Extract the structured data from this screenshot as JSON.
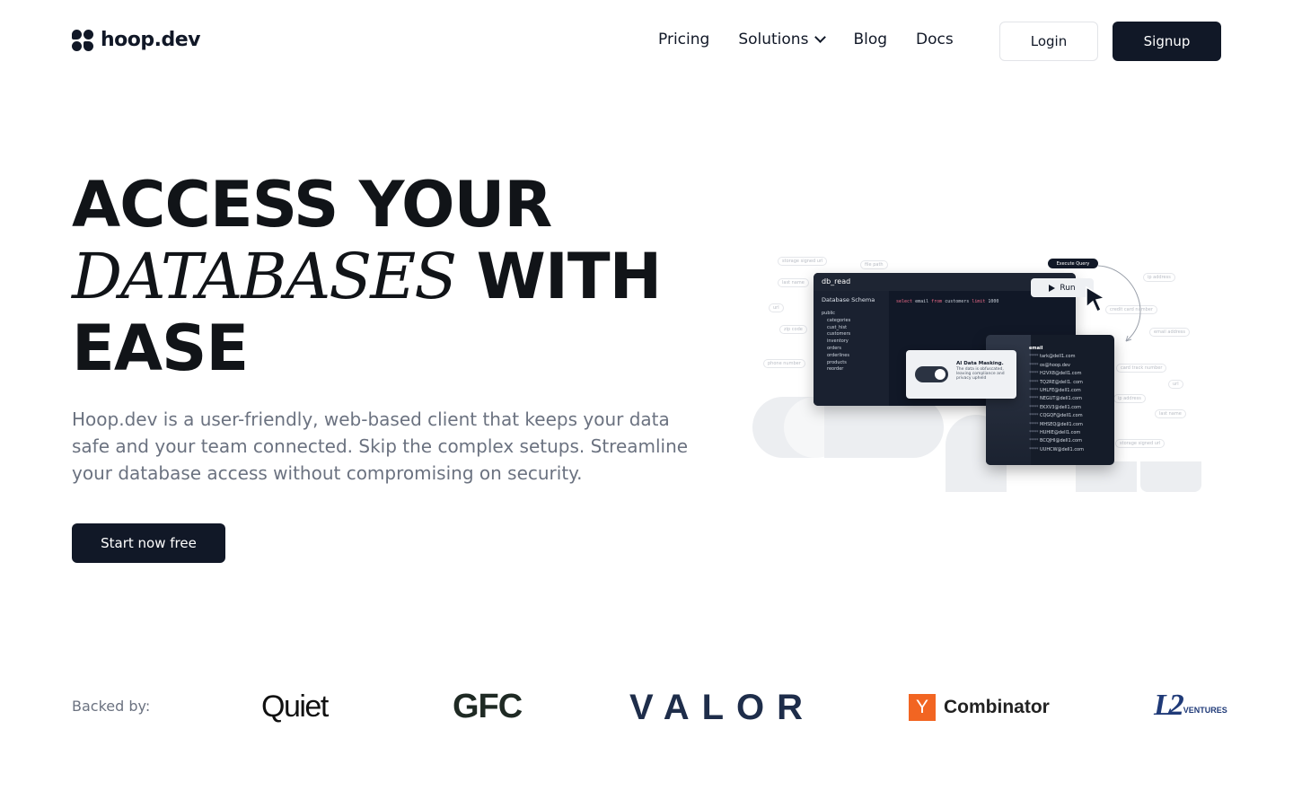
{
  "nav": {
    "logo_text": "hoop.dev",
    "links": [
      {
        "label": "Pricing"
      },
      {
        "label": "Solutions"
      },
      {
        "label": "Blog"
      },
      {
        "label": "Docs"
      }
    ],
    "login_label": "Login",
    "signup_label": "Signup"
  },
  "hero": {
    "title_line1": "ACCESS YOUR",
    "title_italic": "DATABASES",
    "title_line2_rest": " WITH",
    "title_line3": "EASE",
    "subtitle": "Hoop.dev is a user-friendly, web-based client that keeps your data safe and your team connected. Skip the complex setups. Streamline your database access without compromising on security.",
    "cta_label": "Start now free"
  },
  "illustration": {
    "window_title": "db_read",
    "schema_heading": "Database Schema",
    "schema_items": [
      "public",
      "categories",
      "cust_hist",
      "customers",
      "inventory",
      "orders",
      "orderlines",
      "products",
      "reorder"
    ],
    "sql_parts": [
      "select",
      " email ",
      "from",
      " customers ",
      "limit",
      " 1000"
    ],
    "run_label": "Run",
    "execute_label": "Execute Query",
    "masking_title": "AI Data Masking.",
    "masking_desc": "The data is obfuscated, leaving compliance and privacy upheld",
    "email_header": "email",
    "emails": [
      "tark@dell1.com",
      "os@hoop.dev",
      "H2VX8@dell1.com",
      "TQ2RE@dell1. com",
      "UHLFE@dell1.com",
      "NEGUT@dell1.com",
      "EKXV3@dell1.com",
      "CQGQF@dell1.com",
      "MHSEQ@dell1.com",
      "HUHIE@dell1.com",
      "BCQJHI@dell1.com",
      "UUHCW@dell1.com"
    ],
    "mask_glyph": "*****"
  },
  "backed": {
    "label": "Backed by:",
    "brands": {
      "quiet": "Quiet",
      "gfc": "GFC",
      "valor": "VALOR",
      "yc_letter": "Y",
      "yc": "Combinator",
      "l2_mark": "L2",
      "l2_text": "VENTURES"
    }
  },
  "colors": {
    "primary": "#111827",
    "muted": "#6b7280",
    "yc_orange": "#f26522",
    "l2_blue": "#1f3a78"
  }
}
